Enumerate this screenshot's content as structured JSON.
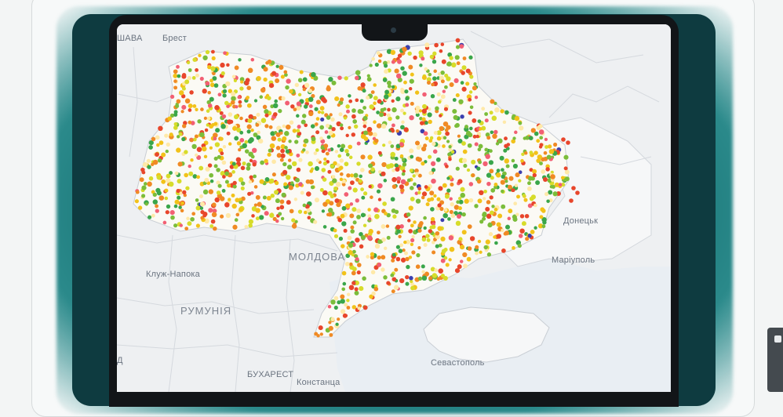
{
  "map": {
    "labels": {
      "warsaw": "ШАВА",
      "brest": "Брест",
      "donetsk": "Донецьк",
      "mariupol": "Маріуполь",
      "moldova": "МОЛДОВА",
      "cluj": "Клуж-Напока",
      "romania": "РУМУНІЯ",
      "sevastopol": "Севастополь",
      "bucharest": "БУХАРЕСТ",
      "constanta": "Констанца",
      "edge_letter": "Д"
    },
    "colors": {
      "background": "#eef0f2",
      "land_other": "#f4f5f6",
      "ukraine_land": "#fbfaf5",
      "borders": "#c9ced4",
      "marker_palette": [
        "#7bbd3a",
        "#3aa64a",
        "#d7dc2a",
        "#f2c21a",
        "#f08a24",
        "#e8462b",
        "#f25f73",
        "#ffe9a8",
        "#3b3fae"
      ],
      "device": "#121518",
      "glow": "#0f6b6d"
    }
  }
}
